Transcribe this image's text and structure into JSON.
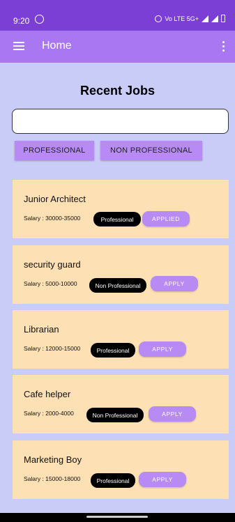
{
  "status_bar": {
    "time": "9:20",
    "right_text": "Vo LTE 5G+",
    "whatsapp_icon": "whatsapp-icon",
    "alarm_icon": "alarm-icon",
    "signal_icon": "signal-icon",
    "battery_icon": "battery-icon"
  },
  "app_bar": {
    "title": "Home",
    "menu_icon": "hamburger-menu-icon",
    "overflow_icon": "more-vertical-icon",
    "color": "#a977f2"
  },
  "heading": "Recent Jobs",
  "search": {
    "value": "",
    "placeholder": ""
  },
  "filters": {
    "professional": "PROFESSIONAL",
    "non_professional": "NON PROFESSIONAL"
  },
  "jobs": [
    {
      "title": "Junior Architect",
      "salary": "Salary : 30000-35000",
      "category": "Professional",
      "action": "APPLIED"
    },
    {
      "title": "security guard",
      "salary": "Salary : 5000-10000",
      "category": "Non Professional",
      "action": "APPLY"
    },
    {
      "title": "Librarian",
      "salary": "Salary : 12000-15000",
      "category": "Professional",
      "action": "APPLY"
    },
    {
      "title": "Cafe helper",
      "salary": "Salary : 2000-4000",
      "category": "Non Professional",
      "action": "APPLY"
    },
    {
      "title": "Marketing Boy",
      "salary": "Salary : 15000-18000",
      "category": "Professional",
      "action": "APPLY"
    }
  ],
  "colors": {
    "status_bar": "#7b3fd6",
    "background": "#c9ccf6",
    "card": "#fde0b4",
    "button": "#b78bf3",
    "tag": "#000000"
  }
}
